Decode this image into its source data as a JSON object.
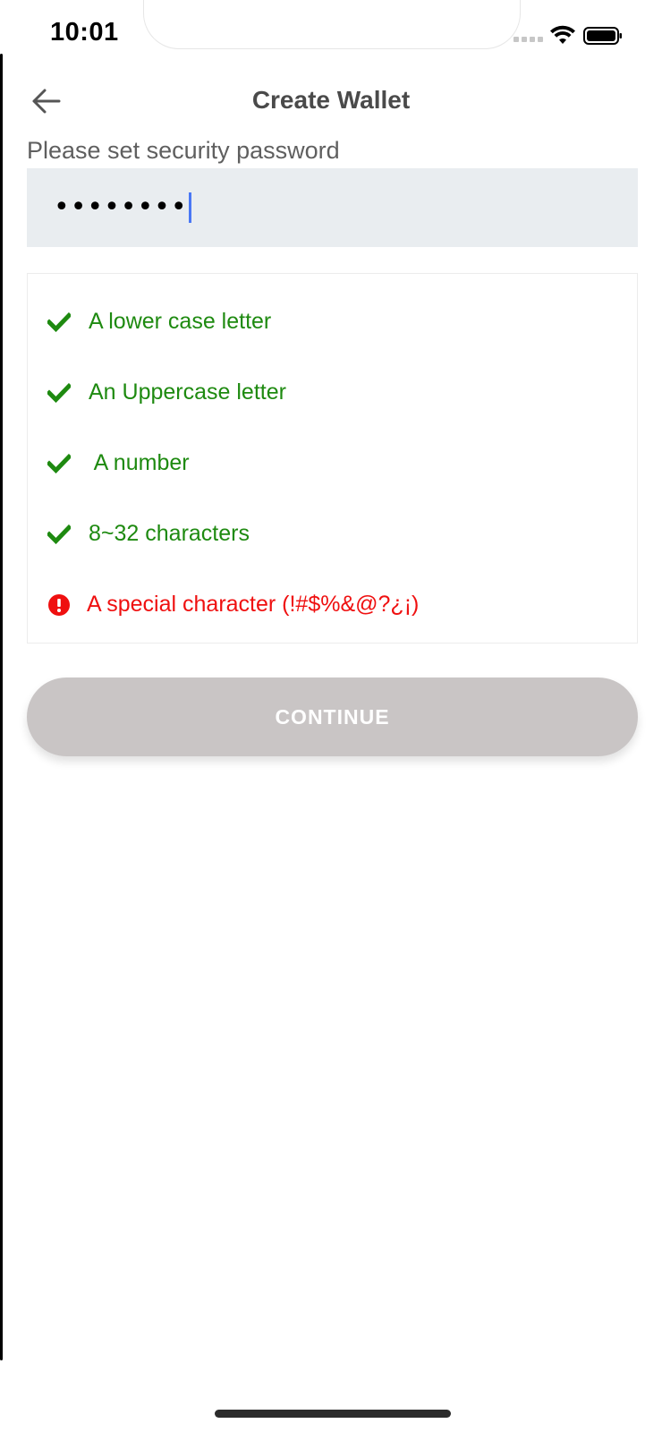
{
  "status_bar": {
    "time": "10:01",
    "icons": [
      "signal-icon",
      "wifi-icon",
      "battery-icon"
    ]
  },
  "nav": {
    "back_icon": "arrow-left-icon",
    "title": "Create Wallet"
  },
  "form": {
    "label": "Please set security password",
    "password_value": "••••••••"
  },
  "rules": [
    {
      "text": "A lower case letter",
      "status": "ok",
      "icon": "check-icon"
    },
    {
      "text": "An Uppercase letter",
      "status": "ok",
      "icon": "check-icon"
    },
    {
      "text": " A number",
      "status": "ok",
      "icon": "check-icon"
    },
    {
      "text": "8~32 characters",
      "status": "ok",
      "icon": "check-icon"
    },
    {
      "text": "A special character (!#$%&@?¿¡)",
      "status": "error",
      "icon": "exclamation-circle-icon"
    }
  ],
  "continue_button": {
    "label": "CONTINUE",
    "enabled": false
  },
  "colors": {
    "ok": "#1e8a10",
    "error": "#ef1010",
    "button_disabled": "#c9c5c5",
    "input_bg": "#e9edf0",
    "caret": "#4a78f5"
  }
}
